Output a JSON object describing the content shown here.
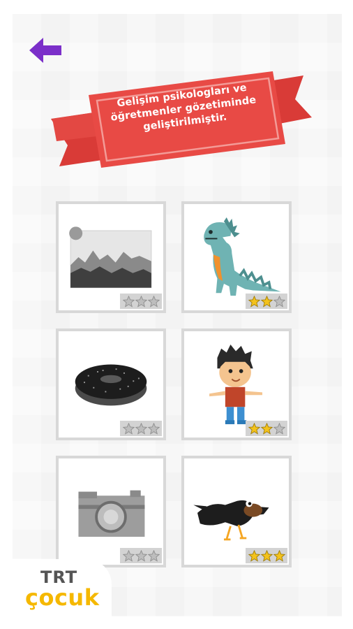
{
  "banner": {
    "line1": "Gelişim psikologları ve",
    "line2": "öğretmenler gözetiminde",
    "line3": "geliştirilmiştir."
  },
  "navigation": {
    "back_icon": "back-arrow-icon"
  },
  "cards": [
    {
      "subject": "landscape",
      "stars_earned": 0,
      "stars_total": 3
    },
    {
      "subject": "dinosaur",
      "stars_earned": 2,
      "stars_total": 3
    },
    {
      "subject": "donut",
      "stars_earned": 0,
      "stars_total": 3
    },
    {
      "subject": "boy",
      "stars_earned": 2,
      "stars_total": 3
    },
    {
      "subject": "camera",
      "stars_earned": 0,
      "stars_total": 3
    },
    {
      "subject": "crow",
      "stars_earned": 3,
      "stars_total": 3
    }
  ],
  "brand": {
    "top": "TRT",
    "bottom": "çocuk"
  },
  "colors": {
    "accent": "#7b2fc9",
    "ribbon": "#e94a45",
    "ribbon_dark": "#c8342f",
    "star_gold": "#f3c21c",
    "star_grey": "#bdbdbd",
    "brand_yellow": "#f5b800"
  }
}
